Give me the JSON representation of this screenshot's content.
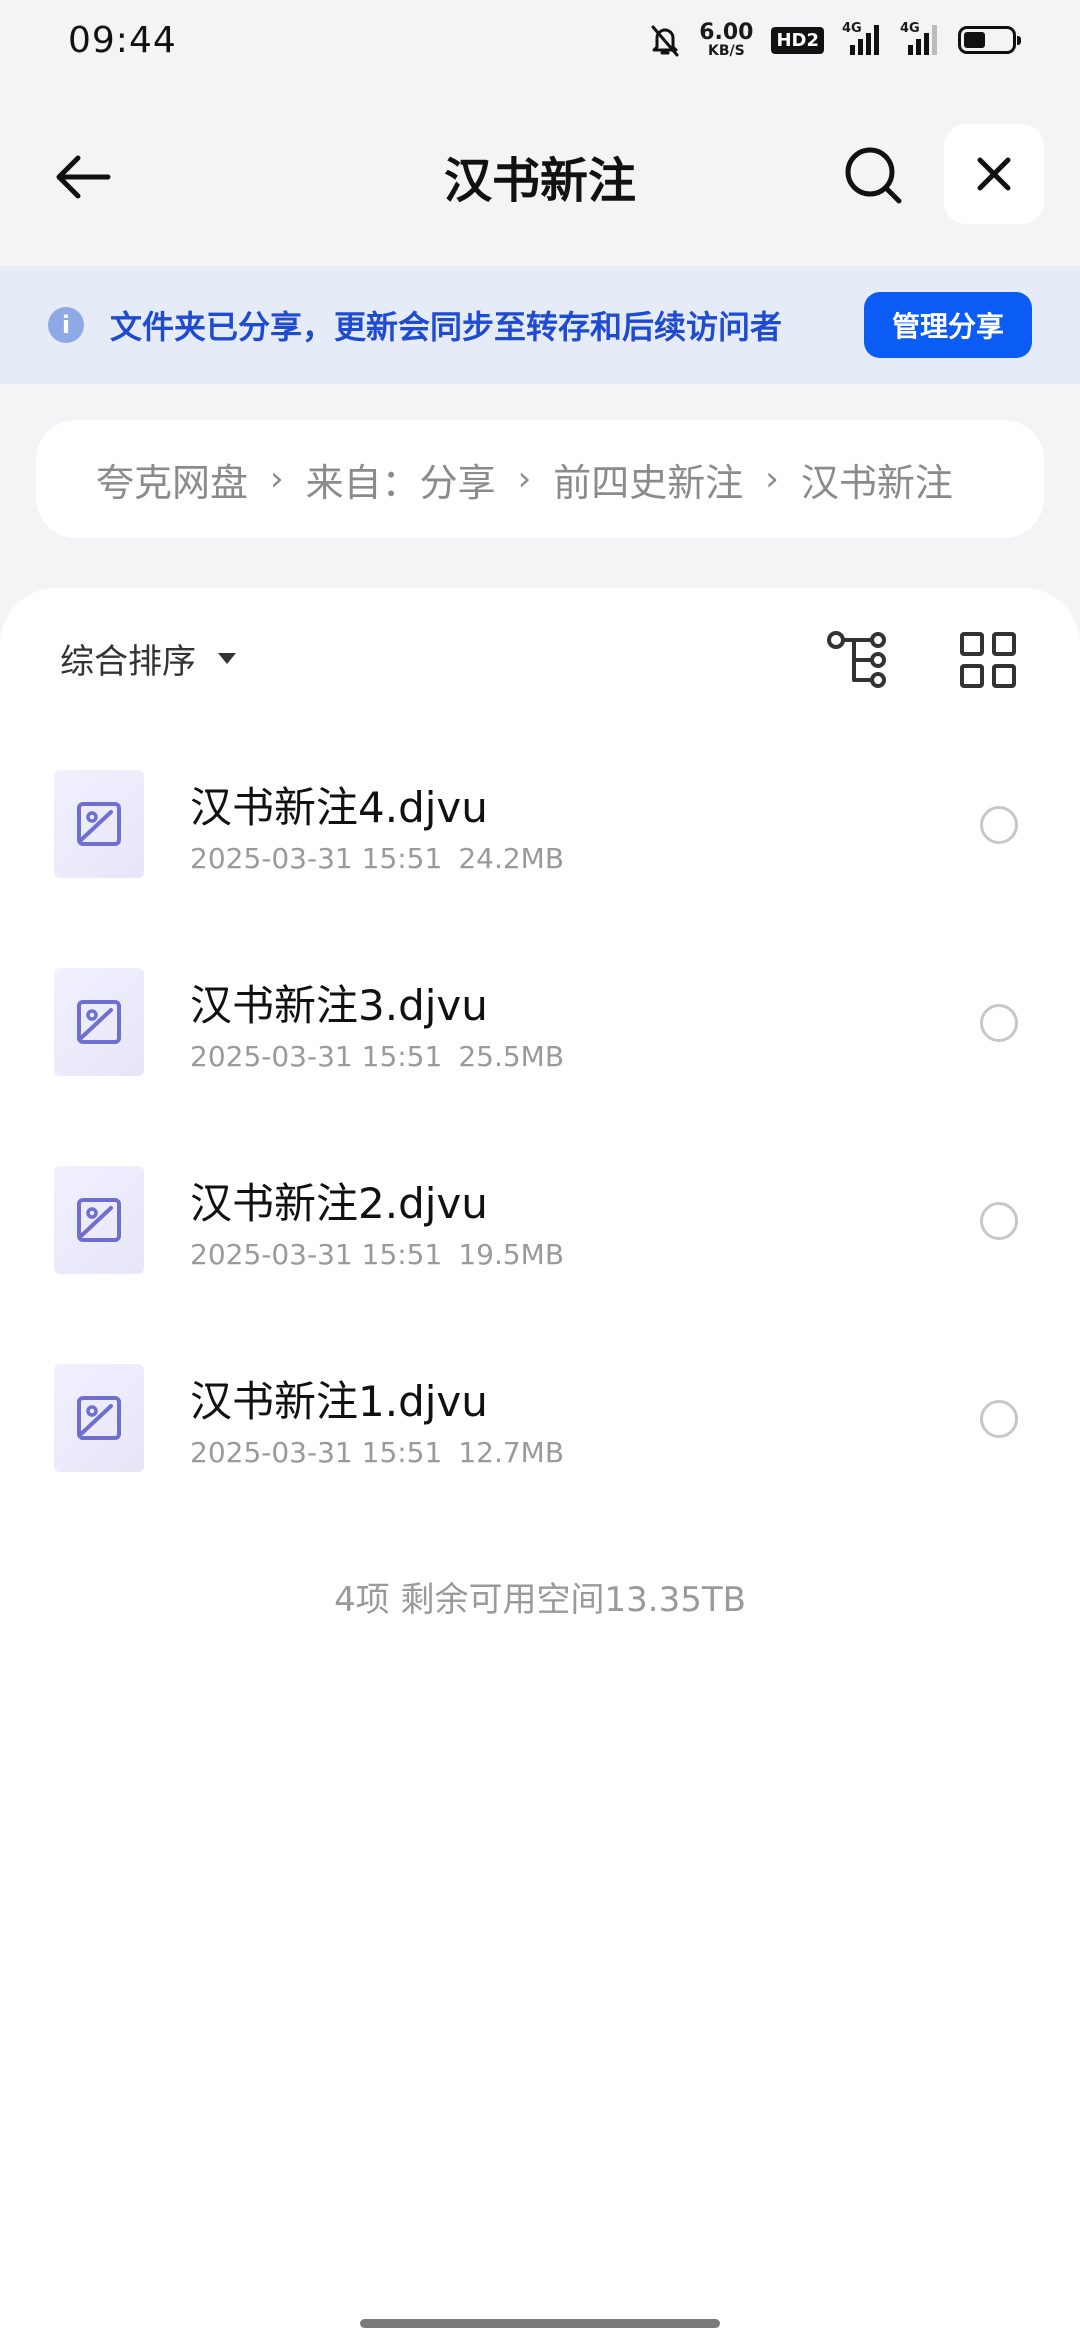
{
  "status_bar": {
    "time": "09:44",
    "net_speed": "6.00",
    "net_unit": "KB/S",
    "hd_label": "HD2",
    "signal1_label": "4G",
    "signal2_label": "4G",
    "battery_level": 0.45,
    "icons": [
      "bell-off-icon",
      "hd-icon",
      "signal-icon",
      "signal-icon",
      "battery-icon"
    ]
  },
  "header": {
    "title": "汉书新注",
    "back_icon": "arrow-left-icon",
    "search_icon": "search-icon",
    "close_icon": "close-icon"
  },
  "banner": {
    "text": "文件夹已分享，更新会同步至转存和后续访问者",
    "button": "管理分享",
    "info_icon": "i"
  },
  "breadcrumb": [
    "夸克网盘",
    "来自：分享",
    "前四史新注",
    "汉书新注"
  ],
  "toolbar": {
    "sort_label": "综合排序"
  },
  "files": [
    {
      "name": "汉书新注4.djvu",
      "date": "2025-03-31 15:51",
      "size": "24.2MB"
    },
    {
      "name": "汉书新注3.djvu",
      "date": "2025-03-31 15:51",
      "size": "25.5MB"
    },
    {
      "name": "汉书新注2.djvu",
      "date": "2025-03-31 15:51",
      "size": "19.5MB"
    },
    {
      "name": "汉书新注1.djvu",
      "date": "2025-03-31 15:51",
      "size": "12.7MB"
    }
  ],
  "summary": "4项 剩余可用空间13.35TB",
  "colors": {
    "accent": "#0a5cf5",
    "banner_bg": "#e6ebf8",
    "banner_text": "#1f4bd1",
    "thumb_icon": "#6f6fd2"
  }
}
